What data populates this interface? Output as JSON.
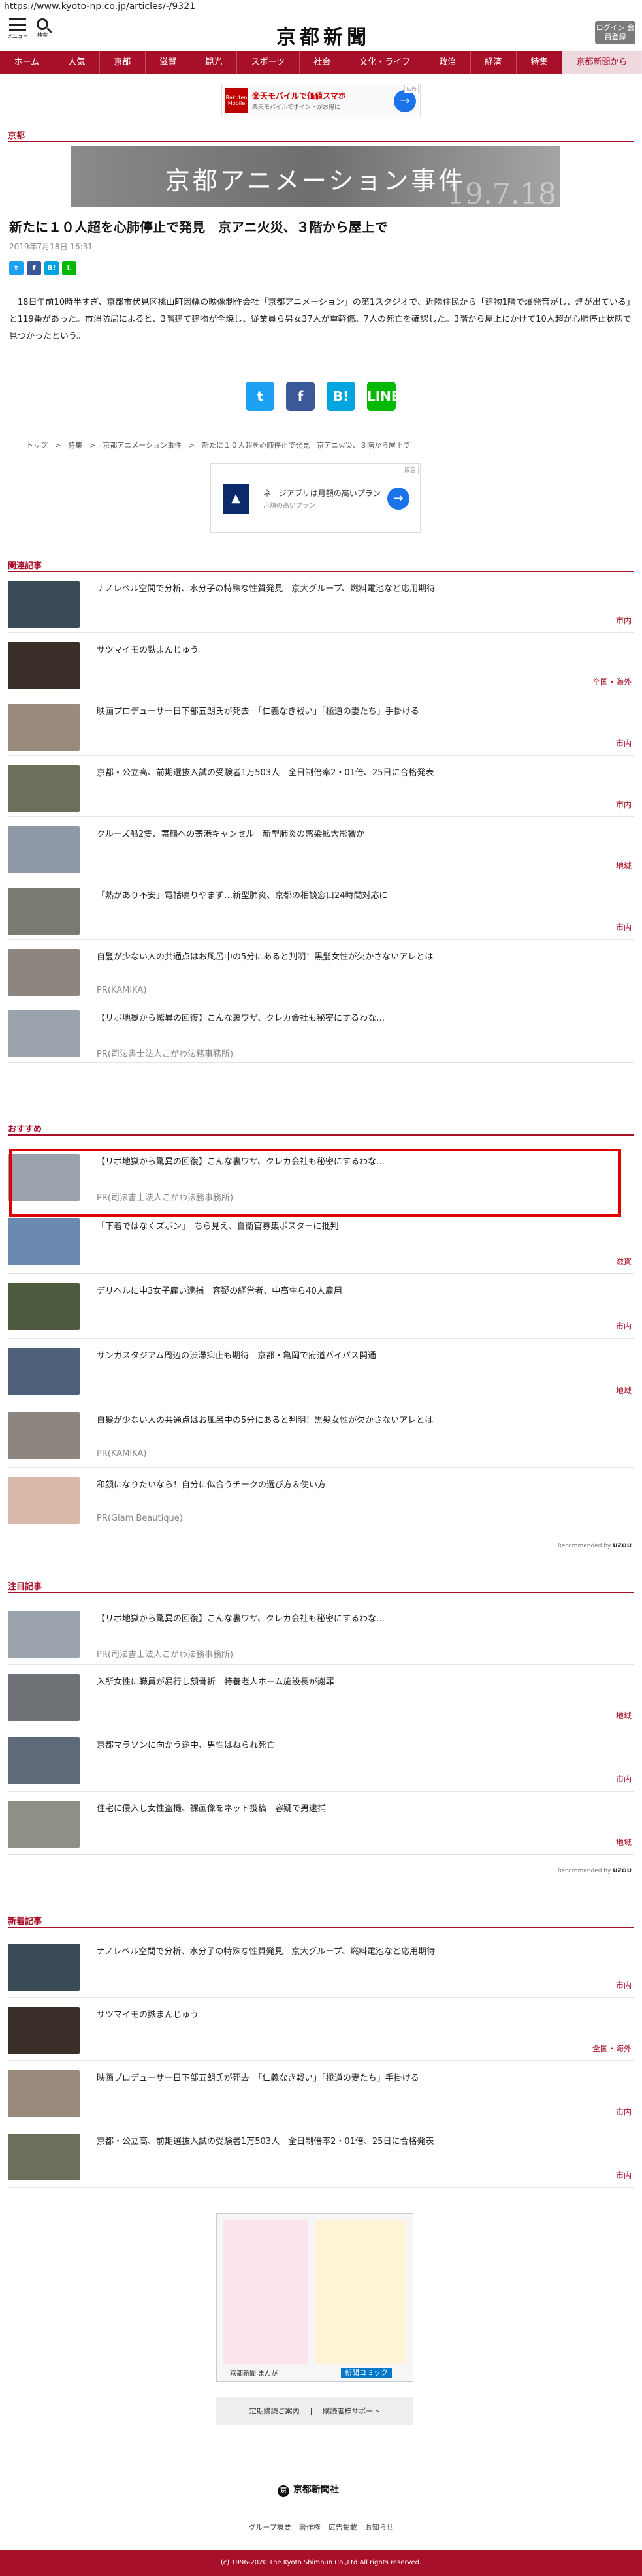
{
  "browser": {
    "url": "https://www.kyoto-np.co.jp/articles/-/9321"
  },
  "header": {
    "menu_caption": "メニュー",
    "search_caption": "検索",
    "logo": "京都新聞",
    "login": "ログイン 会員登録"
  },
  "nav": [
    "ホーム",
    "人気",
    "京都",
    "滋賀",
    "観光",
    "スポーツ",
    "社会",
    "文化・ライフ",
    "政治",
    "経済",
    "特集",
    "京都新聞から"
  ],
  "ad_top": {
    "brand": "Rakuten Mobile",
    "line1": "楽天モバイルで価値スマホ",
    "line2": "楽天モバイルでポイントがお得に",
    "badge": "広告"
  },
  "section_label": "京都",
  "banner": {
    "text": "京都アニメーション事件",
    "date": "19.7.18"
  },
  "article": {
    "headline": "新たに１０人超を心肺停止で発見　京アニ火災、３階から屋上で",
    "date": "2019年7月18日 16:31",
    "body": "18日午前10時半すぎ、京都市伏見区桃山町因幡の映像制作会社「京都アニメーション」の第1スタジオで、近隣住民から「建物1階で爆発音がし、煙が出ている」と119番があった。市消防局によると、3階建て建物が全焼し、従業員ら男女37人が重軽傷。7人の死亡を確認した。3階から屋上にかけて10人超が心肺停止状態で見つかったという。"
  },
  "share_small": [
    {
      "label": "t",
      "color": "#1da1f2"
    },
    {
      "label": "f",
      "color": "#3b5998"
    },
    {
      "label": "B!",
      "color": "#00a4de"
    },
    {
      "label": "L",
      "color": "#00b900"
    }
  ],
  "share_large": [
    {
      "label": "t",
      "color": "#1da1f2",
      "icon": "twitter-icon"
    },
    {
      "label": "f",
      "color": "#3b5998",
      "icon": "facebook-icon"
    },
    {
      "label": "B!",
      "color": "#00a4de",
      "icon": "hatena-icon"
    },
    {
      "label": "LINE",
      "color": "#00b900",
      "icon": "line-icon"
    }
  ],
  "breadcrumb": "トップ　>　特集　>　京都アニメーション事件　>　新たに１０人超を心肺停止で発見　京アニ火災、３階から屋上で",
  "ad_mid": {
    "line1": "ネージアプリは月額の高いプラン",
    "line2": "月額の高いプラン",
    "badge": "広告"
  },
  "related": {
    "label": "関連記事",
    "items": [
      {
        "title": "ナノレベル空間で分析、水分子の特殊な性質発見　京大グループ、燃料電池など応用期待",
        "tag": "市内",
        "thumb": "#3b4a57"
      },
      {
        "title": "サツマイモの麩まんじゅう",
        "tag": "全国・海外",
        "thumb": "#3a2f28"
      },
      {
        "title": "映画プロデューサー日下部五朗氏が死去　「仁義なき戦い」「極道の妻たち」手掛ける",
        "tag": "市内",
        "thumb": "#9a8a7c"
      },
      {
        "title": "京都・公立高、前期選抜入試の受験者1万503人　全日制倍率2・01倍、25日に合格発表",
        "tag": "市内",
        "thumb": "#6b6f5b"
      },
      {
        "title": "クルーズ船2隻、舞鶴への寄港キャンセル　新型肺炎の感染拡大影響か",
        "tag": "地域",
        "thumb": "#8f9aa6"
      },
      {
        "title": "「熱があり不安」電話鳴りやまず…新型肺炎、京都の相談窓口24時間対応に",
        "tag": "市内",
        "thumb": "#7a7a70"
      },
      {
        "title": "自髪が少ない人の共通点はお風呂中の5分にあると判明！黒髪女性が欠かさないアレとは",
        "pr": "PR(KAMIKA)",
        "thumb": "#8d8680"
      },
      {
        "title": "【リボ地獄から驚異の回復】こんな裏ワザ、クレカ会社も秘密にするわな…",
        "pr": "PR(司法書士法人こがわ法務事務所)",
        "thumb": "#9aa3ab"
      }
    ]
  },
  "recommend": {
    "label": "おすすめ",
    "items": [
      {
        "title": "【リボ地獄から驚異の回復】こんな裏ワザ、クレカ会社も秘密にするわな…",
        "pr": "PR(司法書士法人こがわ法務事務所)",
        "thumb": "#9aa3ab"
      },
      {
        "title": "「下着ではなくズボン」　ちら見え、自衛官募集ポスターに批判",
        "tag": "滋賀",
        "thumb": "#6b8ab0"
      },
      {
        "title": "デリヘルに中3女子雇い逮捕　容疑の経営者、中高生ら40人雇用",
        "tag": "市内",
        "thumb": "#4f5b3f"
      },
      {
        "title": "サンガスタジアム周辺の渋滞抑止も期待　京都・亀岡で府道バイパス開通",
        "tag": "地域",
        "thumb": "#4e5f7a"
      },
      {
        "title": "自髪が少ない人の共通点はお風呂中の5分にあると判明！黒髪女性が欠かさないアレとは",
        "pr": "PR(KAMIKA)",
        "thumb": "#8d8680"
      },
      {
        "title": "和顔になりたいなら！自分に似合うチークの選び方＆使い方",
        "pr": "PR(Glam Beautique)",
        "thumb": "#d8b8a8"
      }
    ],
    "recommended_by": "Recommended by",
    "recommended_brand": "UZOU"
  },
  "attention": {
    "label": "注目記事",
    "items": [
      {
        "title": "【リボ地獄から驚異の回復】こんな裏ワザ、クレカ会社も秘密にするわな…",
        "pr": "PR(司法書士法人こがわ法務事務所)",
        "thumb": "#9aa3ab"
      },
      {
        "title": "入所女性に職員が暴行し顔骨折　特養老人ホーム施設長が謝罪",
        "tag": "地域",
        "thumb": "#6f7378"
      },
      {
        "title": "京都マラソンに向かう途中、男性はねられ死亡",
        "tag": "市内",
        "thumb": "#5f6a78"
      },
      {
        "title": "住宅に侵入し女性盗撮、裸画像をネット投稿　容疑で男逮捕",
        "tag": "地域",
        "thumb": "#8e8f86"
      }
    ],
    "recommended_by": "Recommended by",
    "recommended_brand": "UZOU"
  },
  "latest": {
    "label": "新着記事",
    "items": [
      {
        "title": "ナノレベル空間で分析、水分子の特殊な性質発見　京大グループ、燃料電池など応用期待",
        "tag": "市内",
        "thumb": "#3b4a57"
      },
      {
        "title": "サツマイモの麩まんじゅう",
        "tag": "全国・海外",
        "thumb": "#3a2f28"
      },
      {
        "title": "映画プロデューサー日下部五朗氏が死去　「仁義なき戦い」「極道の妻たち」手掛ける",
        "tag": "市内",
        "thumb": "#9a8a7c"
      },
      {
        "title": "京都・公立高、前期選抜入試の受験者1万503人　全日制倍率2・01倍、25日に合格発表",
        "tag": "市内",
        "thumb": "#6b6f5b"
      }
    ]
  },
  "manga": {
    "title": "京都新聞 まんが",
    "badge": "新聞コミック"
  },
  "footer": {
    "links": [
      "定期購読ご案内",
      "購読者様サポート"
    ],
    "logo": "京都新聞社",
    "logo_mark": "京",
    "menu": [
      "グループ概要",
      "著作権",
      "広告掲載",
      "お知らせ"
    ],
    "copyright": "(c) 1996-2020 The Kyoto Shimbun Co.,Ltd All rights reserved."
  }
}
